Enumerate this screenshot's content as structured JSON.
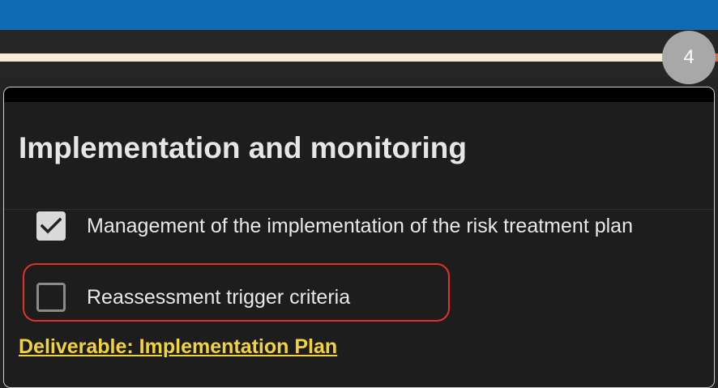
{
  "progress": {
    "step_number": "4",
    "colors": {
      "track": "#f7ecd8",
      "end_accent": "#e0683a",
      "badge": "#a8a8a8"
    }
  },
  "card": {
    "title": "Implementation and monitoring",
    "checklist": [
      {
        "label": "Management of the implementation of the risk treatment plan",
        "checked": true
      },
      {
        "label": "Reassessment trigger criteria",
        "checked": false,
        "highlighted": true
      }
    ],
    "deliverable_link": "Deliverable: Implementation Plan"
  },
  "colors": {
    "top_bar": "#0e6bb4",
    "highlight_border": "#e0322b",
    "link": "#f3d33c"
  },
  "icons": {
    "checked": "checkmark-icon"
  }
}
